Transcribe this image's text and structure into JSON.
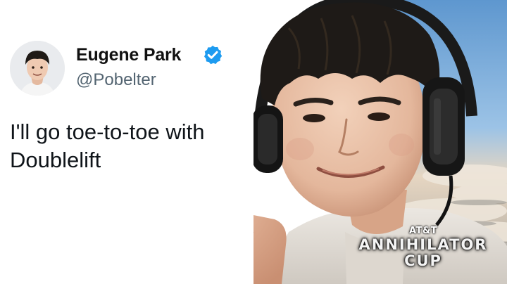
{
  "tweet": {
    "display_name": "Eugene Park",
    "handle": "@Pobelter",
    "text_line1": "I'll go toe-to-toe with",
    "text_line2": "Doublelift",
    "verified_icon": "verified-badge-icon",
    "avatar_icon": "profile-avatar"
  },
  "event_logo": {
    "sponsor": "AT&T",
    "line1": "ANNIHILATOR",
    "line2": "CUP"
  },
  "colors": {
    "name_text": "#111111",
    "handle_text": "#536471",
    "verified_blue": "#1d9bf0",
    "sky_blue": "#7fb0dc",
    "cloud_white": "#e9e4dc"
  }
}
